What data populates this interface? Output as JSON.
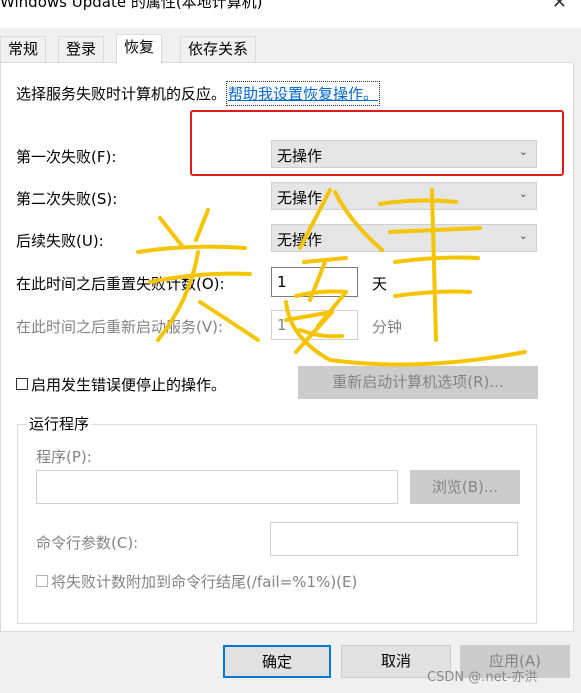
{
  "window": {
    "title": "Windows Update 的属性(本地计算机)",
    "close_glyph": "✕"
  },
  "tabs": [
    {
      "label": "常规",
      "active": false
    },
    {
      "label": "登录",
      "active": false
    },
    {
      "label": "恢复",
      "active": true
    },
    {
      "label": "依存关系",
      "active": false
    }
  ],
  "recovery": {
    "intro": "选择服务失败时计算机的反应。",
    "help_link": "帮助我设置恢复操作。",
    "first_failure": {
      "label": "第一次失败(F):",
      "value": "无操作"
    },
    "second_failure": {
      "label": "第二次失败(S):",
      "value": "无操作"
    },
    "subsequent_failures": {
      "label": "后续失败(U):",
      "value": "无操作"
    },
    "reset_fail_count": {
      "label": "在此时间之后重置失败计数(O):",
      "value": "1",
      "unit": "天"
    },
    "restart_service": {
      "label": "在此时间之后重新启动服务(V):",
      "value": "1",
      "unit": "分钟"
    },
    "enable_actions": {
      "label": "启用发生错误便停止的操作。",
      "checked": false
    },
    "restart_options_button": "重新启动计算机选项(R)..."
  },
  "run_program": {
    "legend": "运行程序",
    "program_label": "程序(P):",
    "program_value": "",
    "browse_button": "浏览(B)...",
    "params_label": "命令行参数(C):",
    "params_value": "",
    "append_fail_count": {
      "label": "将失败计数附加到命令行结尾(/fail=%1%)(E)",
      "checked": false
    }
  },
  "footer": {
    "ok": "确定",
    "cancel": "取消",
    "apply": "应用(A)"
  },
  "watermark": "CSDN @.net-亦洪",
  "annotation": {
    "handwritten": "关键",
    "color": "#f5c400",
    "box_color": "#e21b1b"
  },
  "chevron_icon": "chevron-down-icon"
}
